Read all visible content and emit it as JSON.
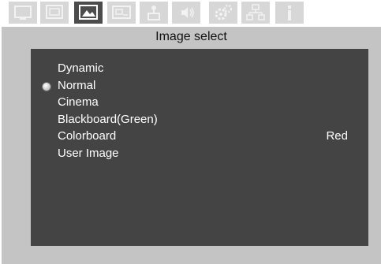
{
  "tabs": [
    {
      "icon": "display-icon"
    },
    {
      "icon": "screen-adjust-icon"
    },
    {
      "icon": "image-icon",
      "active": true
    },
    {
      "icon": "setup-icon"
    },
    {
      "icon": "input-icon"
    },
    {
      "icon": "audio-icon"
    },
    {
      "icon": "settings-gear-icon"
    },
    {
      "icon": "network-icon"
    },
    {
      "icon": "info-icon"
    }
  ],
  "window": {
    "title": "Image select"
  },
  "options": [
    {
      "label": "Dynamic",
      "selected": false
    },
    {
      "label": "Normal",
      "selected": true
    },
    {
      "label": "Cinema",
      "selected": false
    },
    {
      "label": "Blackboard(Green)",
      "selected": false
    },
    {
      "label": "Colorboard",
      "selected": false,
      "value": "Red"
    },
    {
      "label": "User Image",
      "selected": false
    }
  ],
  "colors": {
    "panel": "#444444",
    "window": "#c4c4c4",
    "tab_active": "#4c4c4c",
    "tab_inactive": "#d7d7d7"
  }
}
